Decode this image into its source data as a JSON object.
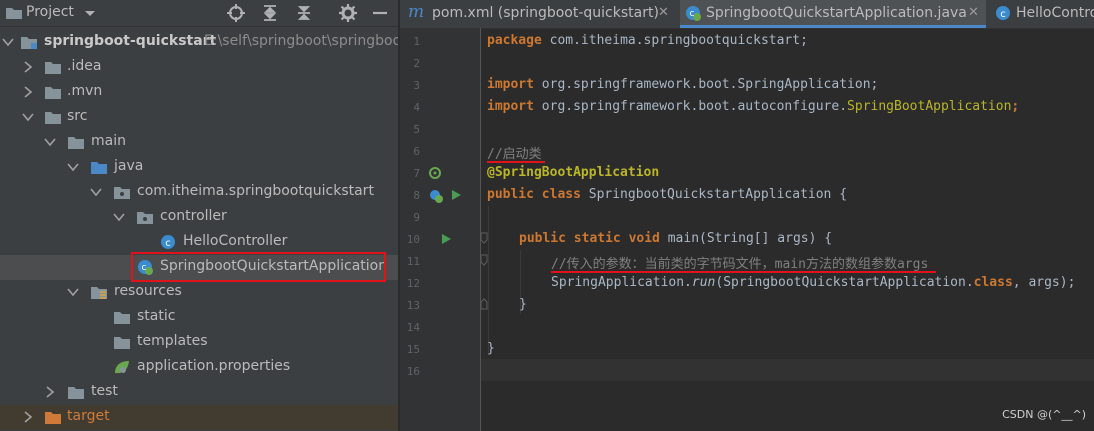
{
  "project_panel": {
    "title": "Project",
    "tree": [
      {
        "label": "springboot-quickstart",
        "path": "E:\\self\\springboot\\springboo",
        "icon": "module-folder-icon"
      },
      {
        "label": ".idea",
        "icon": "folder-icon"
      },
      {
        "label": ".mvn",
        "icon": "folder-icon"
      },
      {
        "label": "src",
        "icon": "folder-icon"
      },
      {
        "label": "main",
        "icon": "folder-icon"
      },
      {
        "label": "java",
        "icon": "source-folder-icon"
      },
      {
        "label": "com.itheima.springbootquickstart",
        "icon": "package-icon"
      },
      {
        "label": "controller",
        "icon": "package-icon"
      },
      {
        "label": "HelloController",
        "icon": "class-icon"
      },
      {
        "label": "SpringbootQuickstartApplication",
        "icon": "spring-boot-class-icon"
      },
      {
        "label": "resources",
        "icon": "resources-folder-icon"
      },
      {
        "label": "static",
        "icon": "folder-icon"
      },
      {
        "label": "templates",
        "icon": "folder-icon"
      },
      {
        "label": "application.properties",
        "icon": "spring-properties-icon"
      },
      {
        "label": "test",
        "icon": "folder-icon"
      },
      {
        "label": "target",
        "icon": "excluded-folder-icon"
      }
    ]
  },
  "tabs": [
    {
      "label": "pom.xml (springboot-quickstart)",
      "icon": "maven-icon"
    },
    {
      "label": "SpringbootQuickstartApplication.java",
      "icon": "spring-boot-class-icon",
      "active": true
    },
    {
      "label": "HelloContro",
      "icon": "class-icon"
    }
  ],
  "editor": {
    "line_numbers": [
      "1",
      "2",
      "3",
      "4",
      "5",
      "6",
      "7",
      "8",
      "9",
      "10",
      "11",
      "12",
      "13",
      "14",
      "15",
      "16"
    ],
    "lines": {
      "l1_kw": "package",
      "l1_rest": " com.itheima.springbootquickstart;",
      "l3_kw": "import",
      "l3_rest": " org.springframework.boot.SpringApplication;",
      "l4_kw": "import",
      "l4_rest": " org.springframework.boot.autoconfigure.",
      "l4_ann": "SpringBootApplication",
      "l4_end": ";",
      "l6_cmt": "//启动类",
      "l7_ann": "@SpringBootApplication",
      "l8_kw": "public class",
      "l8_rest": " SpringbootQuickstartApplication {",
      "l10_kw": "public static void",
      "l10_rest": " main(String[] args) {",
      "l11_cmt": "//传入的参数：当前类的字节码文件，main方法的数组参数args",
      "l12_a": "SpringApplication.",
      "l12_it": "run",
      "l12_b": "(SpringbootQuickstartApplication.",
      "l12_kw": "class",
      "l12_c": ", args);",
      "l13": "}",
      "l15": "}"
    }
  },
  "watermark": "CSDN @(^__^)",
  "colors": {
    "keyword": "#cc7832",
    "annotation": "#bbb529",
    "comment": "#808080",
    "highlight_box": "#e0121c"
  }
}
